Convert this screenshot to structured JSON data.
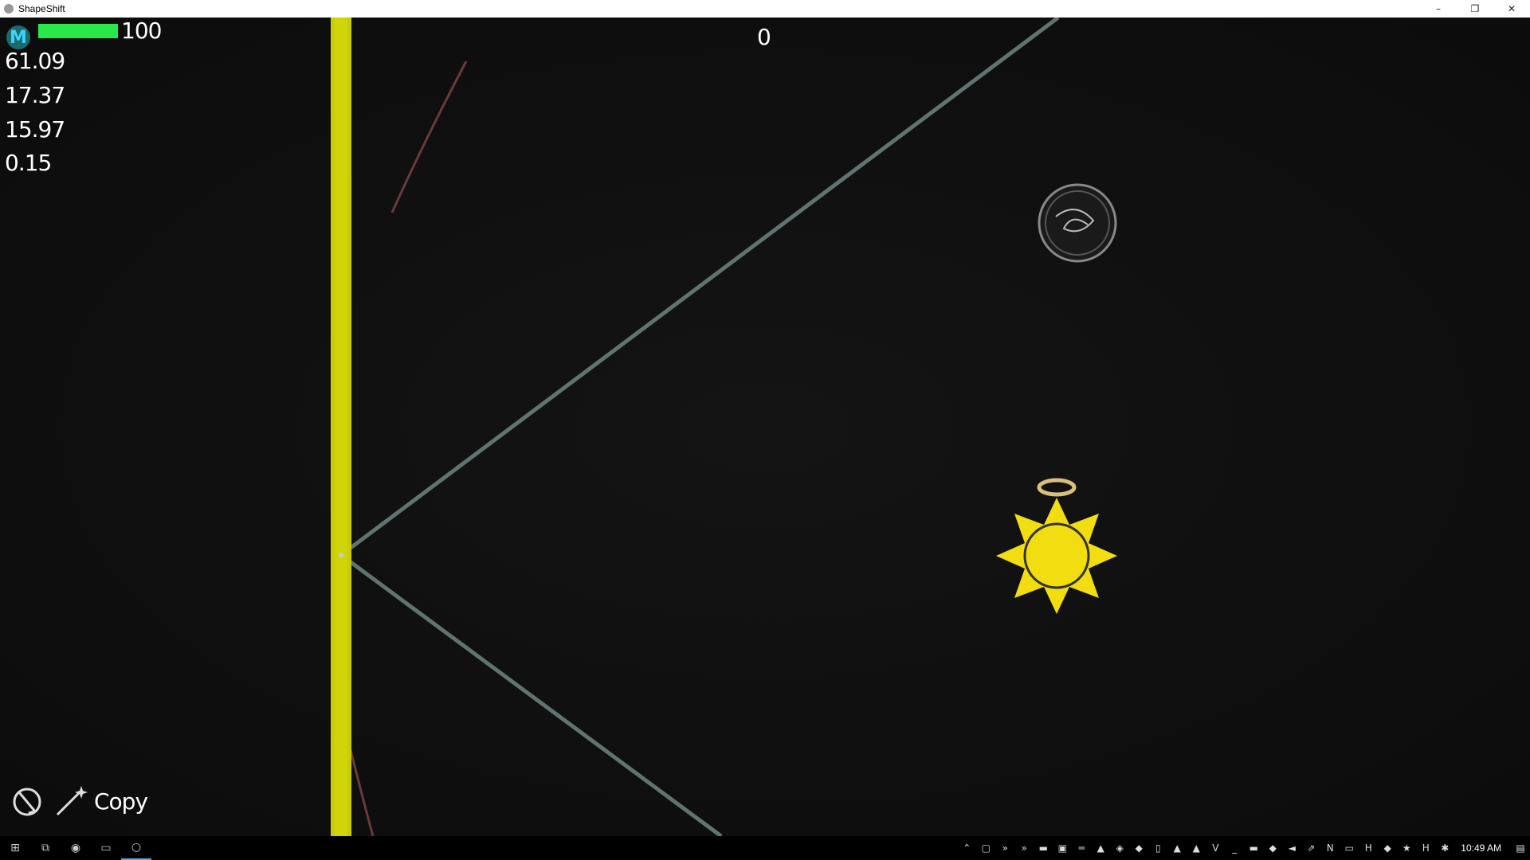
{
  "window": {
    "title": "ShapeShift",
    "controls": [
      "–",
      "❐",
      "✕"
    ]
  },
  "hud": {
    "avatar_letter": "M",
    "health_value": "100",
    "health_fraction": 1.0,
    "score": "0",
    "stats": [
      "61.09",
      "17.37",
      "15.97",
      "0.15"
    ],
    "copy_label": "Copy"
  },
  "colors": {
    "wall": "#c8cc00",
    "beam": "#5f7470",
    "sun": "#f2dd10",
    "halo": "#d9c07a",
    "health": "#29e84a"
  },
  "icons": [
    "gesture-icon",
    "wand-icon",
    "orb-icon",
    "sun-enemy-icon",
    "halo-icon"
  ],
  "taskbar": {
    "apps": [
      "windows-start-icon",
      "task-view-icon",
      "browser-icon",
      "editor-icon",
      "shapeshift-app-icon"
    ],
    "tray": [
      "chevron-up-icon",
      "window-icon",
      "double-chevron-icon",
      "double-chevron-icon",
      "drive-icon",
      "lock-icon",
      "network-icon",
      "chart-icon",
      "leaf-icon",
      "gamepad-icon",
      "usb-icon",
      "vlc-icon",
      "vlc-icon",
      "v-icon",
      "terminal-icon",
      "battery-icon",
      "shield-icon",
      "volume-icon",
      "arrow-icon",
      "notion-icon",
      "monitor-icon",
      "h-icon",
      "defender-icon",
      "star-icon",
      "h-icon",
      "wifi-icon"
    ],
    "clock": "10:49 AM"
  }
}
